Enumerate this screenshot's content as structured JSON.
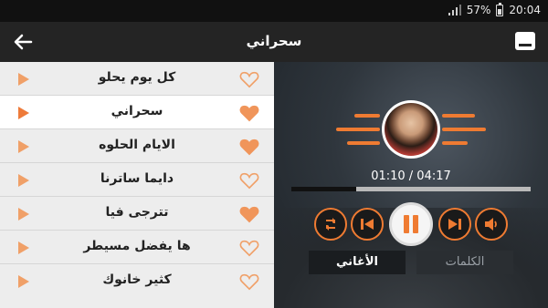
{
  "status_bar": {
    "battery_text": "57%",
    "time": "20:04",
    "icons": [
      "signal-icon",
      "battery-icon"
    ]
  },
  "app_bar": {
    "title": "سحراني",
    "icons": [
      "back-arrow-icon",
      "lyrics-view-icon"
    ]
  },
  "songs": [
    {
      "title": "كل يوم يحلو",
      "favorite": false,
      "active": false
    },
    {
      "title": "سحراني",
      "favorite": true,
      "active": true
    },
    {
      "title": "الايام الحلوه",
      "favorite": true,
      "active": false
    },
    {
      "title": "دايما ساترنا",
      "favorite": false,
      "active": false
    },
    {
      "title": "تترجى فيا",
      "favorite": true,
      "active": false
    },
    {
      "title": "ها يفضل مسيطر",
      "favorite": false,
      "active": false
    },
    {
      "title": "كثير خانوك",
      "favorite": false,
      "active": false
    }
  ],
  "player": {
    "time_display": "01:10 / 04:17",
    "progress": 0.27,
    "controls": [
      "repeat-icon",
      "previous-icon",
      "pause-icon",
      "next-icon",
      "volume-icon"
    ],
    "tabs": {
      "lyrics": "الكلمات",
      "songs": "الأغاني"
    }
  },
  "colors": {
    "accent": "#ef7b32",
    "list_bg": "#ededed",
    "heart_filled": "#f0955a",
    "heart_outline": "#f0a068"
  }
}
